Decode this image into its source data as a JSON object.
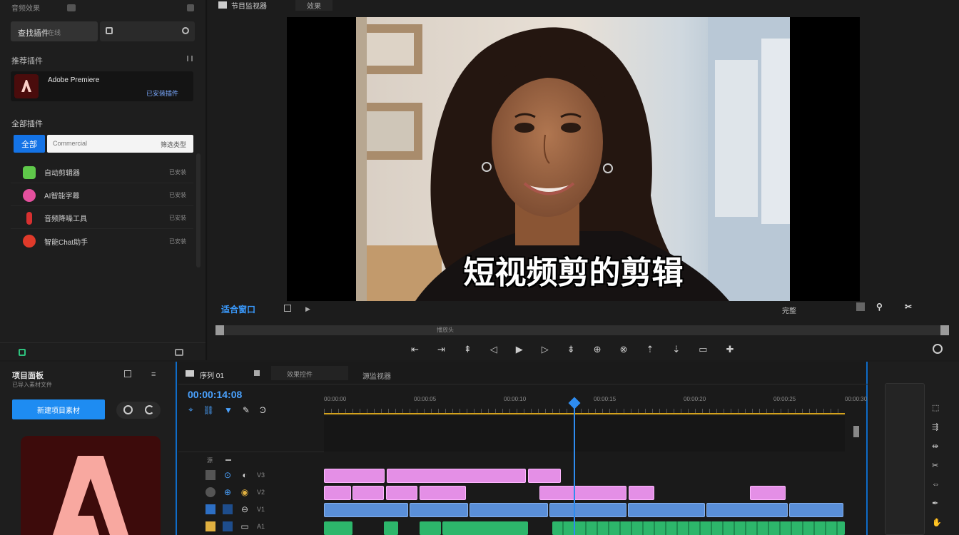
{
  "left_panel": {
    "header_left": "音频效果",
    "search": {
      "tab_label": "查找插件",
      "tab_sub": "在线",
      "placeholder": ""
    },
    "recommended": {
      "title": "推荐插件",
      "app_name": "Adobe Premiere",
      "install_label": "已安装插件"
    },
    "category": {
      "title": "全部插件",
      "chip": "全部",
      "input_value": "Commercial",
      "filter_label": "筛选类型"
    },
    "extensions": [
      {
        "name": "自动剪辑器",
        "meta": "已安装",
        "color": "#5fc84a"
      },
      {
        "name": "AI智能字幕",
        "meta": "已安装",
        "color": "#e4509e"
      },
      {
        "name": "音频降噪工具",
        "meta": "已安装",
        "color": "#d83030"
      },
      {
        "name": "智能Chat助手",
        "meta": "已安装",
        "color": "#e03a2a"
      }
    ]
  },
  "viewer": {
    "tab_title": "节目监视器",
    "tab_second": "效果",
    "subtitle": "短视频剪的剪辑",
    "timecode": "适合窗口",
    "zoom_label": "完整",
    "scrub_label": "播放头"
  },
  "bottom_left": {
    "title": "项目面板",
    "subtitle": "已导入素材文件",
    "primary_button": "新建项目素材",
    "logo_colors": {
      "bg": "#3a0a0a",
      "mark": "#f8a8a0"
    }
  },
  "timeline": {
    "tab_title": "序列 01",
    "tab_second": "效果控件",
    "tab_third": "源监视器",
    "timecode": "00:00:14:08",
    "ruler": [
      "00:00:00",
      "00:00:05",
      "00:00:10",
      "00:00:15",
      "00:00:20",
      "00:00:25",
      "00:00:30"
    ],
    "track_labels": [
      "V3",
      "V2",
      "V1",
      "A1"
    ],
    "playhead_fraction": 0.48
  }
}
